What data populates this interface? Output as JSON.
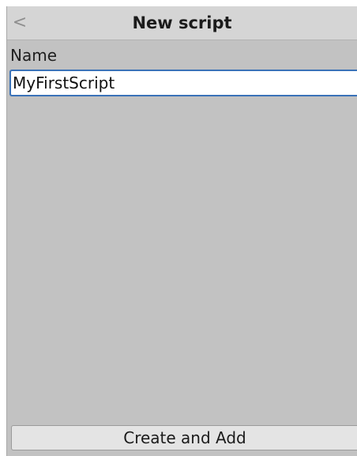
{
  "header": {
    "back_icon": "chevron-left-icon",
    "back_glyph": "<",
    "title": "New script"
  },
  "form": {
    "name_label": "Name",
    "name_value": "MyFirstScript"
  },
  "footer": {
    "create_label": "Create and Add"
  },
  "colors": {
    "panel_background": "#c2c2c2",
    "header_background": "#d5d5d5",
    "input_focus_border": "#3a72b8",
    "button_background": "#e4e4e4"
  }
}
